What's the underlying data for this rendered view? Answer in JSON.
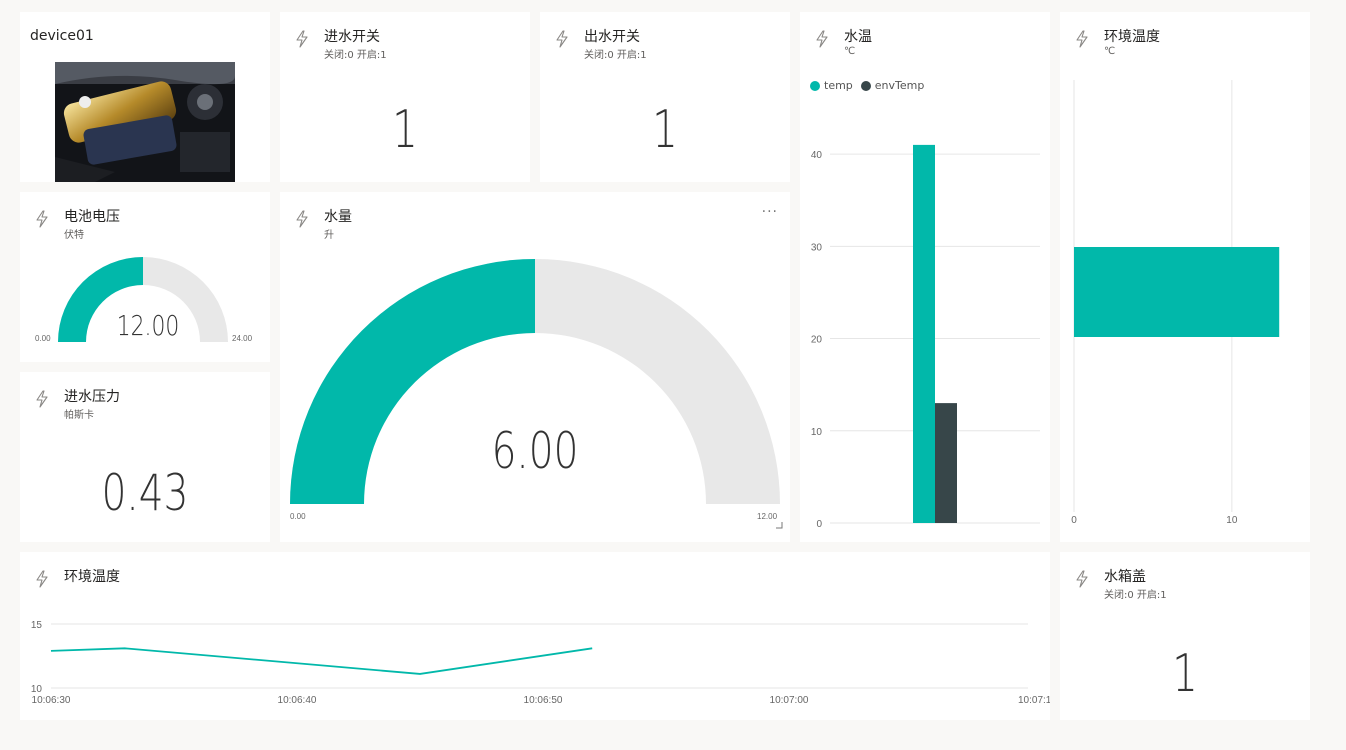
{
  "colors": {
    "accent": "#01b8aa",
    "dark": "#374649",
    "track": "#e8e8e8"
  },
  "device": {
    "title": "device01",
    "image": "car-engine-image"
  },
  "inlet_switch": {
    "title": "进水开关",
    "subtitle": "关闭:0 开启:1",
    "value": "1",
    "icon": "bolt-icon"
  },
  "outlet_switch": {
    "title": "出水开关",
    "subtitle": "关闭:0 开启:1",
    "value": "1",
    "icon": "bolt-icon"
  },
  "battery": {
    "title": "电池电压",
    "subtitle": "伏特",
    "value": "12.00",
    "min": "0.00",
    "max": "24.00",
    "fraction": 0.5,
    "icon": "bolt-icon"
  },
  "pressure": {
    "title": "进水压力",
    "subtitle": "帕斯卡",
    "value": "0.43",
    "icon": "bolt-icon"
  },
  "water_volume": {
    "title": "水量",
    "subtitle": "升",
    "value": "6.00",
    "min": "0.00",
    "max": "12.00",
    "fraction": 0.5,
    "more": "···",
    "icon": "bolt-icon"
  },
  "water_temp": {
    "title": "水温",
    "subtitle": "℃",
    "icon": "bolt-icon"
  },
  "env_temp_bar": {
    "title": "环境温度",
    "subtitle": "℃",
    "icon": "bolt-icon"
  },
  "env_temp_line": {
    "title": "环境温度",
    "icon": "bolt-icon"
  },
  "tank_lid": {
    "title": "水箱盖",
    "subtitle": "关闭:0 开启:1",
    "value": "1",
    "icon": "bolt-icon"
  },
  "chart_data": [
    {
      "type": "bar",
      "categories": [
        ""
      ],
      "series": [
        {
          "name": "temp",
          "values": [
            41
          ],
          "color": "#01b8aa"
        },
        {
          "name": "envTemp",
          "values": [
            13
          ],
          "color": "#374649"
        }
      ],
      "title": "水温",
      "subtitle": "℃",
      "ylim": [
        0,
        45
      ],
      "yticks": [
        "0",
        "10",
        "20",
        "30",
        "40"
      ],
      "legend": "top-left",
      "grid": true
    },
    {
      "type": "bar",
      "orientation": "horizontal",
      "categories": [
        ""
      ],
      "series": [
        {
          "values": [
            13
          ],
          "color": "#01b8aa"
        }
      ],
      "title": "环境温度",
      "subtitle": "℃",
      "xlim": [
        0,
        14
      ],
      "xticks": [
        "0",
        "10"
      ],
      "grid": true
    },
    {
      "type": "line",
      "title": "环境温度",
      "x": [
        "10:06:30",
        "10:06:33",
        "10:06:45",
        "10:06:52"
      ],
      "values": [
        12.9,
        13.1,
        11.1,
        13.1
      ],
      "color": "#01b8aa",
      "ylim": [
        10,
        15
      ],
      "yticks": [
        "10",
        "15"
      ],
      "xticks": [
        "10:06:30",
        "10:06:40",
        "10:06:50",
        "10:07:00",
        "10:07:10"
      ],
      "grid": true
    }
  ]
}
